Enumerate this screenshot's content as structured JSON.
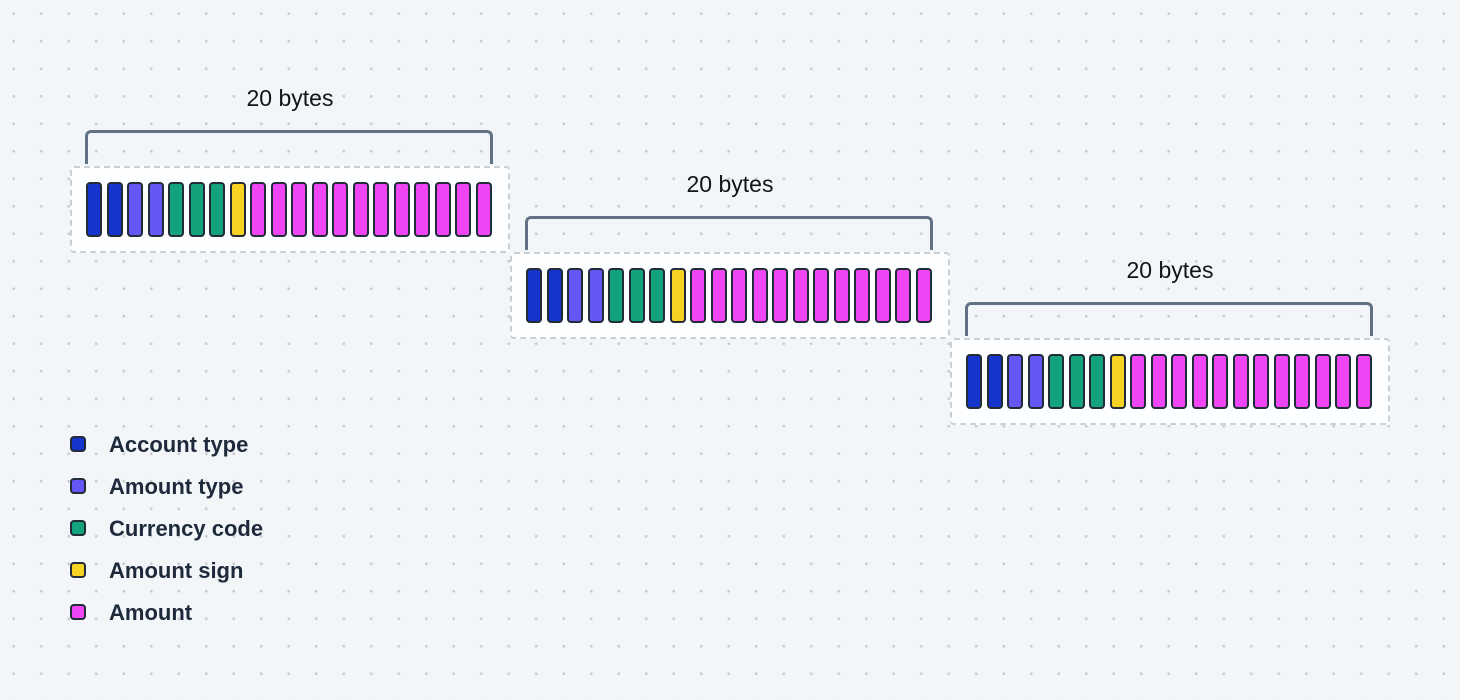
{
  "fields": [
    {
      "key": "account_type",
      "label": "Account type",
      "color": "#1434cb",
      "bytes": 2
    },
    {
      "key": "amount_type",
      "label": "Amount type",
      "color": "#6557f5",
      "bytes": 2
    },
    {
      "key": "currency_code",
      "label": "Currency code",
      "color": "#12a37c",
      "bytes": 3
    },
    {
      "key": "amount_sign",
      "label": "Amount sign",
      "color": "#f6d223",
      "bytes": 1
    },
    {
      "key": "amount",
      "label": "Amount",
      "color": "#ef45f5",
      "bytes": 12
    }
  ],
  "records": [
    {
      "label": "20 bytes"
    },
    {
      "label": "20 bytes"
    },
    {
      "label": "20 bytes"
    }
  ],
  "legend": {
    "items": [
      {
        "label": "Account type",
        "color": "#1434cb"
      },
      {
        "label": "Amount type",
        "color": "#6557f5"
      },
      {
        "label": "Currency code",
        "color": "#12a37c"
      },
      {
        "label": "Amount sign",
        "color": "#f6d223"
      },
      {
        "label": "Amount",
        "color": "#ef45f5"
      }
    ]
  }
}
